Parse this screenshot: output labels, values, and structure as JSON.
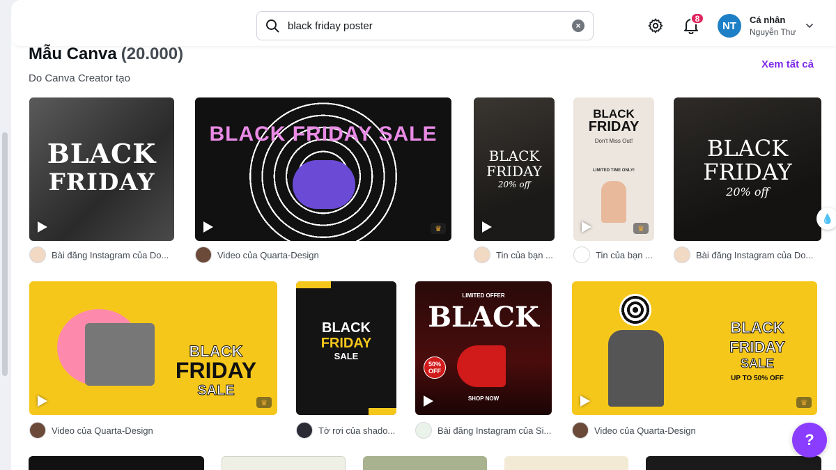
{
  "search": {
    "query": "black friday poster"
  },
  "notifications": {
    "count": "8"
  },
  "account": {
    "initials": "NT",
    "title": "Cá nhân",
    "name": "Nguyễn Thư"
  },
  "section": {
    "title": "Mẫu Canva",
    "count": "(20.000)",
    "subtitle": "Do Canva Creator tạo",
    "see_all": "Xem tất cả"
  },
  "templates": [
    {
      "label": "Bài đăng Instagram của Do...",
      "thumb_text_1": "BLACK",
      "thumb_text_2": "FRIDAY"
    },
    {
      "label": "Video của Quarta-Design",
      "thumb_text_1": "BLACK FRIDAY SALE"
    },
    {
      "label": "Tin của bạn ...",
      "thumb_text_1": "BLACK",
      "thumb_text_2": "FRIDAY",
      "thumb_text_3": "20% off"
    },
    {
      "label": "Tin của bạn ...",
      "thumb_text_1": "BLACK",
      "thumb_text_2": "FRIDAY",
      "thumb_text_3": "Don't Miss Out!",
      "thumb_text_4": "LIMITED TIME ONLY!"
    },
    {
      "label": "Bài đăng Instagram của Do...",
      "thumb_text_1": "BLACK",
      "thumb_text_2": "FRIDAY",
      "thumb_text_3": "20% off"
    },
    {
      "label": "Video của Quarta-Design",
      "thumb_text_1": "BLACK",
      "thumb_text_2": "FRIDAY",
      "thumb_text_3": "SALE"
    },
    {
      "label": "Tờ rơi của shado...",
      "thumb_text_1": "BLACK",
      "thumb_text_2": "FRIDAY",
      "thumb_text_3": "SALE"
    },
    {
      "label": "Bài đăng Instagram của Si...",
      "thumb_text_1": "LIMITED OFFER",
      "thumb_text_2": "BLACK",
      "thumb_text_3": "50% OFF",
      "thumb_text_4": "SHOP NOW"
    },
    {
      "label": "Video của Quarta-Design",
      "thumb_text_1": "BLACK",
      "thumb_text_2": "FRIDAY",
      "thumb_text_3": "SALE",
      "thumb_text_4": "UP TO 50% OFF"
    }
  ],
  "help": {
    "label": "?"
  },
  "colors": {
    "accent": "#7d2ae8",
    "help": "#8b3dff",
    "badge": "#e0245e",
    "avatar": "#1d7fc5"
  }
}
